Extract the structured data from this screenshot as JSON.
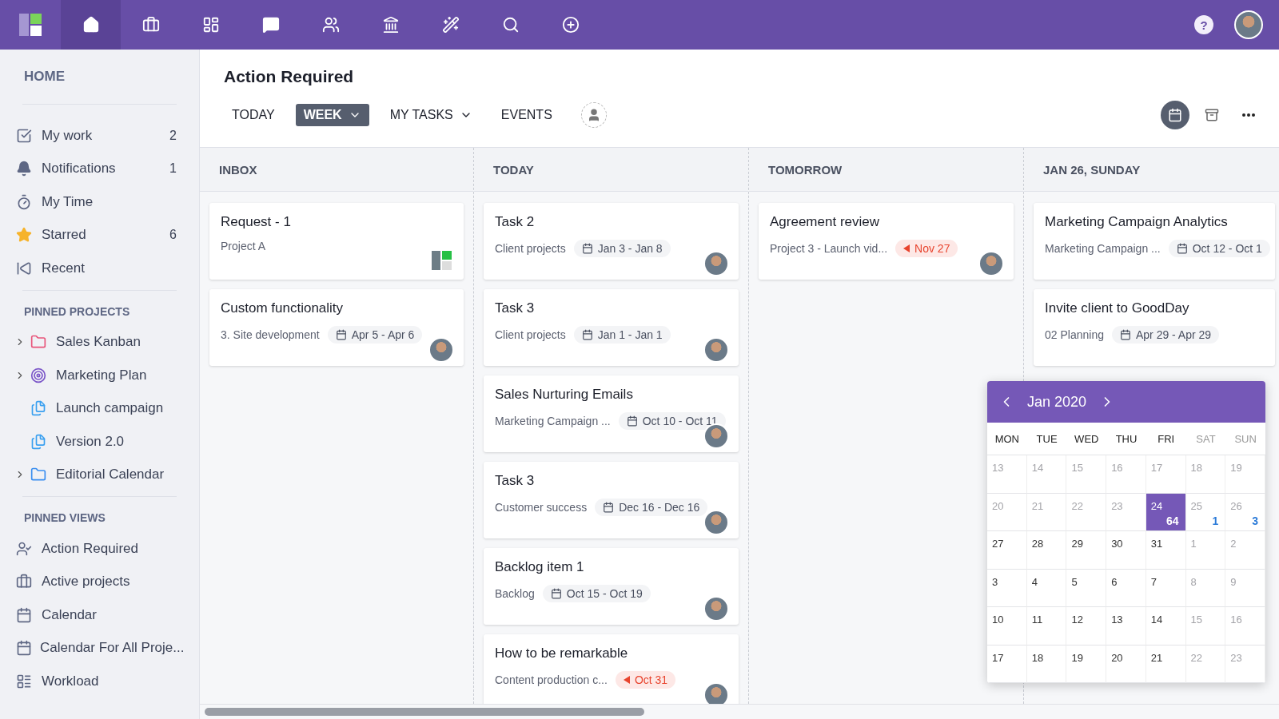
{
  "top_nav": {
    "items": [
      {
        "selected": true
      },
      {
        "selected": false
      },
      {
        "selected": false
      },
      {
        "selected": false
      },
      {
        "selected": false
      },
      {
        "selected": false
      },
      {
        "selected": false
      },
      {
        "selected": false
      },
      {
        "selected": false
      }
    ],
    "help": "?"
  },
  "sidebar": {
    "title": "HOME",
    "main_items": [
      {
        "label": "My work",
        "count": "2"
      },
      {
        "label": "Notifications",
        "count": "1"
      },
      {
        "label": "My Time"
      },
      {
        "label": "Starred",
        "count": "6"
      },
      {
        "label": "Recent"
      }
    ],
    "pinned_projects": {
      "title": "PINNED PROJECTS",
      "items": [
        {
          "label": "Sales Kanban",
          "expandable": true
        },
        {
          "label": "Marketing Plan",
          "expandable": true
        },
        {
          "label": "Launch campaign",
          "expandable": false
        },
        {
          "label": "Version 2.0",
          "expandable": false
        },
        {
          "label": "Editorial Calendar",
          "expandable": true
        }
      ]
    },
    "pinned_views": {
      "title": "PINNED VIEWS",
      "items": [
        {
          "label": "Action Required"
        },
        {
          "label": "Active projects"
        },
        {
          "label": "Calendar"
        },
        {
          "label": "Calendar For All Proje..."
        },
        {
          "label": "Workload"
        }
      ]
    }
  },
  "page_title": "Action Required",
  "filters": [
    {
      "label": "TODAY",
      "selected": false,
      "dropdown": false
    },
    {
      "label": "WEEK",
      "selected": true,
      "dropdown": true
    },
    {
      "label": "MY TASKS",
      "selected": false,
      "dropdown": true
    },
    {
      "label": "EVENTS",
      "selected": false,
      "dropdown": false
    }
  ],
  "view_buttons": [
    {
      "selected": true
    },
    {
      "selected": false
    }
  ],
  "columns": [
    {
      "title": "INBOX",
      "cards": [
        {
          "title": "Request - 1",
          "project": "Project A",
          "logo": true
        },
        {
          "title": "Custom functionality",
          "project": "3. Site development",
          "date": {
            "kind": "range",
            "text": "Apr 5 - Apr 6"
          },
          "avatar": true
        }
      ]
    },
    {
      "title": "TODAY",
      "cards": [
        {
          "title": "Task 2",
          "project": "Client projects",
          "date": {
            "kind": "range",
            "text": "Jan 3 - Jan 8"
          },
          "avatar": true
        },
        {
          "title": "Task 3",
          "project": "Client projects",
          "date": {
            "kind": "range",
            "text": "Jan 1 - Jan 1"
          },
          "avatar": true
        },
        {
          "title": "Sales Nurturing Emails",
          "project": "Marketing Campaign ...",
          "date": {
            "kind": "range",
            "text": "Oct 10 - Oct 11"
          },
          "avatar": true
        },
        {
          "title": "Task 3",
          "project": "Customer success",
          "date": {
            "kind": "range",
            "text": "Dec 16 - Dec 16"
          },
          "avatar": true
        },
        {
          "title": "Backlog item 1",
          "project": "Backlog",
          "date": {
            "kind": "range",
            "text": "Oct 15 - Oct 19"
          },
          "avatar": true
        },
        {
          "title": "How to be remarkable",
          "project": "Content production c...",
          "date": {
            "kind": "overdue",
            "text": "Oct 31"
          },
          "avatar": true
        }
      ]
    },
    {
      "title": "TOMORROW",
      "cards": [
        {
          "title": "Agreement review",
          "project": "Project 3 - Launch vid...",
          "date": {
            "kind": "overdue",
            "text": "Nov 27"
          },
          "avatar": true
        }
      ]
    },
    {
      "title": "JAN 26, SUNDAY",
      "cards": [
        {
          "title": "Marketing Campaign Analytics",
          "project": "Marketing Campaign ...",
          "date": {
            "kind": "range",
            "text": "Oct 12 - Oct 1"
          }
        },
        {
          "title": "Invite client to GoodDay",
          "project": "02 Planning",
          "date": {
            "kind": "range",
            "text": "Apr 29 - Apr 29"
          }
        }
      ]
    }
  ],
  "calendar": {
    "month": "Jan 2020",
    "weekdays": [
      {
        "label": "MON",
        "weekend": false
      },
      {
        "label": "TUE",
        "weekend": false
      },
      {
        "label": "WED",
        "weekend": false
      },
      {
        "label": "THU",
        "weekend": false
      },
      {
        "label": "FRI",
        "weekend": false
      },
      {
        "label": "SAT",
        "weekend": true
      },
      {
        "label": "SUN",
        "weekend": true
      }
    ],
    "weeks": [
      [
        {
          "day": "13",
          "muted": true,
          "selected": false
        },
        {
          "day": "14",
          "muted": true,
          "selected": false
        },
        {
          "day": "15",
          "muted": true,
          "selected": false
        },
        {
          "day": "16",
          "muted": true,
          "selected": false
        },
        {
          "day": "17",
          "muted": true,
          "selected": false
        },
        {
          "day": "18",
          "muted": true,
          "selected": false
        },
        {
          "day": "19",
          "muted": true,
          "selected": false
        }
      ],
      [
        {
          "day": "20",
          "muted": true,
          "selected": false
        },
        {
          "day": "21",
          "muted": true,
          "selected": false
        },
        {
          "day": "22",
          "muted": true,
          "selected": false
        },
        {
          "day": "23",
          "muted": true,
          "selected": false
        },
        {
          "day": "24",
          "muted": false,
          "selected": true,
          "count": "64"
        },
        {
          "day": "25",
          "muted": true,
          "selected": false,
          "count": "1"
        },
        {
          "day": "26",
          "muted": true,
          "selected": false,
          "count": "3"
        }
      ],
      [
        {
          "day": "27",
          "muted": false,
          "selected": false
        },
        {
          "day": "28",
          "muted": false,
          "selected": false
        },
        {
          "day": "29",
          "muted": false,
          "selected": false
        },
        {
          "day": "30",
          "muted": false,
          "selected": false
        },
        {
          "day": "31",
          "muted": false,
          "selected": false
        },
        {
          "day": "1",
          "muted": true,
          "selected": false
        },
        {
          "day": "2",
          "muted": true,
          "selected": false
        }
      ],
      [
        {
          "day": "3",
          "muted": false,
          "selected": false
        },
        {
          "day": "4",
          "muted": false,
          "selected": false
        },
        {
          "day": "5",
          "muted": false,
          "selected": false
        },
        {
          "day": "6",
          "muted": false,
          "selected": false
        },
        {
          "day": "7",
          "muted": false,
          "selected": false
        },
        {
          "day": "8",
          "muted": true,
          "selected": false
        },
        {
          "day": "9",
          "muted": true,
          "selected": false
        }
      ],
      [
        {
          "day": "10",
          "muted": false,
          "selected": false
        },
        {
          "day": "11",
          "muted": false,
          "selected": false
        },
        {
          "day": "12",
          "muted": false,
          "selected": false
        },
        {
          "day": "13",
          "muted": false,
          "selected": false
        },
        {
          "day": "14",
          "muted": false,
          "selected": false
        },
        {
          "day": "15",
          "muted": true,
          "selected": false
        },
        {
          "day": "16",
          "muted": true,
          "selected": false
        }
      ],
      [
        {
          "day": "17",
          "muted": false,
          "selected": false
        },
        {
          "day": "18",
          "muted": false,
          "selected": false
        },
        {
          "day": "19",
          "muted": false,
          "selected": false
        },
        {
          "day": "20",
          "muted": false,
          "selected": false
        },
        {
          "day": "21",
          "muted": false,
          "selected": false
        },
        {
          "day": "22",
          "muted": true,
          "selected": false
        },
        {
          "day": "23",
          "muted": true,
          "selected": false
        }
      ]
    ]
  }
}
